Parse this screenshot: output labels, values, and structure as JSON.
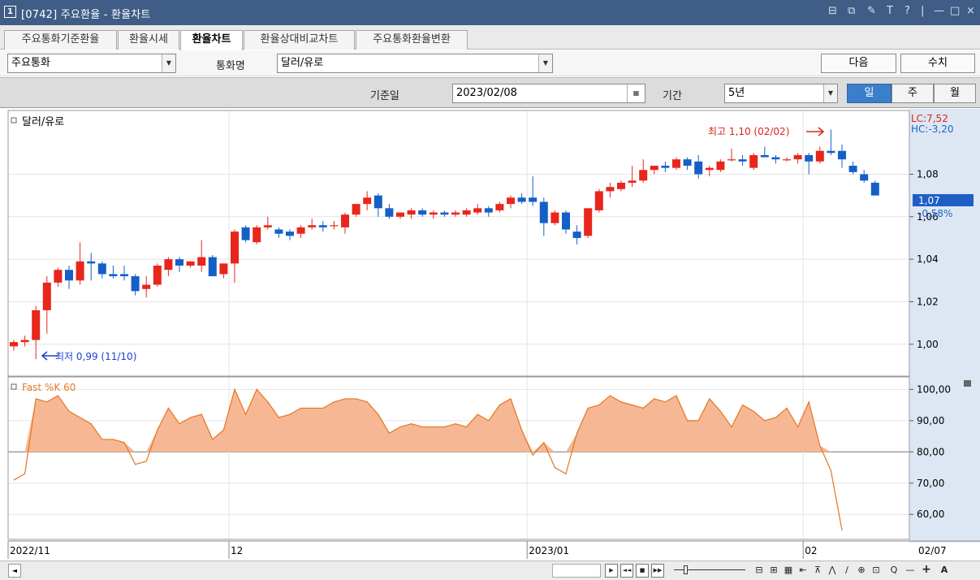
{
  "window": {
    "number": "1",
    "title": "[0742] 주요환율 - 환율차트",
    "controls": [
      "⊟",
      "⧉",
      "✎",
      "T",
      "?",
      "|",
      "—",
      "□",
      "×"
    ]
  },
  "tabs": [
    {
      "label": "주요통화기준환율",
      "active": false
    },
    {
      "label": "환율시세",
      "active": false
    },
    {
      "label": "환율차트",
      "active": true
    },
    {
      "label": "환율상대비교차트",
      "active": false
    },
    {
      "label": "주요통화환율변환",
      "active": false
    }
  ],
  "toolbar": {
    "category_value": "주요통화",
    "currency_label": "통화명",
    "currency_value": "달러/유로",
    "next_label": "다음",
    "value_label": "수치"
  },
  "filters": {
    "base_date_label": "기준일",
    "base_date_value": "2023/02/08",
    "period_label": "기간",
    "period_value": "5년",
    "day_label": "일",
    "week_label": "주",
    "month_label": "월"
  },
  "chart_data": [
    {
      "type": "candlestick",
      "title": "달러/유로",
      "ylim": [
        0.985,
        1.11
      ],
      "yticks": [
        1.0,
        1.02,
        1.04,
        1.06,
        1.08
      ],
      "ytick_labels": [
        "1,00",
        "1,02",
        "1,04",
        "1,06",
        "1,08"
      ],
      "x_labels": [
        "2022/11",
        "12",
        "2023/01",
        "02"
      ],
      "x_label_index": [
        0,
        20,
        47,
        72
      ],
      "last_x_label": "02/07",
      "annotations": {
        "high": "최고 1,10 (02/02)",
        "low": "최저 0,99 (11/10)",
        "lc": "LC:7,52",
        "hc": "HC:-3,20",
        "current": "1,07",
        "change": "-0,58%"
      },
      "candles": [
        {
          "o": 0.999,
          "h": 1.002,
          "l": 0.997,
          "c": 1.001
        },
        {
          "o": 1.001,
          "h": 1.004,
          "l": 0.999,
          "c": 1.002
        },
        {
          "o": 1.002,
          "h": 1.018,
          "l": 0.993,
          "c": 1.016
        },
        {
          "o": 1.016,
          "h": 1.032,
          "l": 1.005,
          "c": 1.029
        },
        {
          "o": 1.029,
          "h": 1.036,
          "l": 1.027,
          "c": 1.035
        },
        {
          "o": 1.035,
          "h": 1.037,
          "l": 1.026,
          "c": 1.03
        },
        {
          "o": 1.03,
          "h": 1.048,
          "l": 1.028,
          "c": 1.039
        },
        {
          "o": 1.039,
          "h": 1.043,
          "l": 1.03,
          "c": 1.038
        },
        {
          "o": 1.038,
          "h": 1.039,
          "l": 1.031,
          "c": 1.033
        },
        {
          "o": 1.033,
          "h": 1.037,
          "l": 1.031,
          "c": 1.032
        },
        {
          "o": 1.033,
          "h": 1.037,
          "l": 1.03,
          "c": 1.032
        },
        {
          "o": 1.032,
          "h": 1.033,
          "l": 1.023,
          "c": 1.025
        },
        {
          "o": 1.026,
          "h": 1.032,
          "l": 1.022,
          "c": 1.028
        },
        {
          "o": 1.028,
          "h": 1.038,
          "l": 1.027,
          "c": 1.037
        },
        {
          "o": 1.035,
          "h": 1.041,
          "l": 1.032,
          "c": 1.04
        },
        {
          "o": 1.04,
          "h": 1.041,
          "l": 1.034,
          "c": 1.037
        },
        {
          "o": 1.037,
          "h": 1.039,
          "l": 1.036,
          "c": 1.039
        },
        {
          "o": 1.037,
          "h": 1.049,
          "l": 1.034,
          "c": 1.041
        },
        {
          "o": 1.041,
          "h": 1.042,
          "l": 1.032,
          "c": 1.032
        },
        {
          "o": 1.033,
          "h": 1.038,
          "l": 1.031,
          "c": 1.038
        },
        {
          "o": 1.038,
          "h": 1.054,
          "l": 1.029,
          "c": 1.053
        },
        {
          "o": 1.055,
          "h": 1.056,
          "l": 1.048,
          "c": 1.049
        },
        {
          "o": 1.048,
          "h": 1.056,
          "l": 1.047,
          "c": 1.055
        },
        {
          "o": 1.055,
          "h": 1.06,
          "l": 1.054,
          "c": 1.056
        },
        {
          "o": 1.054,
          "h": 1.055,
          "l": 1.05,
          "c": 1.052
        },
        {
          "o": 1.053,
          "h": 1.054,
          "l": 1.049,
          "c": 1.051
        },
        {
          "o": 1.052,
          "h": 1.056,
          "l": 1.05,
          "c": 1.055
        },
        {
          "o": 1.055,
          "h": 1.059,
          "l": 1.054,
          "c": 1.056
        },
        {
          "o": 1.056,
          "h": 1.058,
          "l": 1.053,
          "c": 1.055
        },
        {
          "o": 1.056,
          "h": 1.058,
          "l": 1.054,
          "c": 1.056
        },
        {
          "o": 1.055,
          "h": 1.062,
          "l": 1.052,
          "c": 1.061
        },
        {
          "o": 1.061,
          "h": 1.066,
          "l": 1.06,
          "c": 1.066
        },
        {
          "o": 1.066,
          "h": 1.072,
          "l": 1.063,
          "c": 1.069
        },
        {
          "o": 1.07,
          "h": 1.071,
          "l": 1.06,
          "c": 1.064
        },
        {
          "o": 1.064,
          "h": 1.066,
          "l": 1.059,
          "c": 1.06
        },
        {
          "o": 1.06,
          "h": 1.062,
          "l": 1.059,
          "c": 1.062
        },
        {
          "o": 1.061,
          "h": 1.064,
          "l": 1.059,
          "c": 1.063
        },
        {
          "o": 1.063,
          "h": 1.064,
          "l": 1.06,
          "c": 1.061
        },
        {
          "o": 1.061,
          "h": 1.063,
          "l": 1.059,
          "c": 1.062
        },
        {
          "o": 1.062,
          "h": 1.063,
          "l": 1.06,
          "c": 1.061
        },
        {
          "o": 1.061,
          "h": 1.063,
          "l": 1.06,
          "c": 1.062
        },
        {
          "o": 1.061,
          "h": 1.064,
          "l": 1.06,
          "c": 1.063
        },
        {
          "o": 1.062,
          "h": 1.066,
          "l": 1.061,
          "c": 1.064
        },
        {
          "o": 1.064,
          "h": 1.065,
          "l": 1.06,
          "c": 1.062
        },
        {
          "o": 1.063,
          "h": 1.067,
          "l": 1.062,
          "c": 1.066
        },
        {
          "o": 1.066,
          "h": 1.07,
          "l": 1.064,
          "c": 1.069
        },
        {
          "o": 1.069,
          "h": 1.071,
          "l": 1.066,
          "c": 1.067
        },
        {
          "o": 1.069,
          "h": 1.079,
          "l": 1.065,
          "c": 1.067
        },
        {
          "o": 1.067,
          "h": 1.069,
          "l": 1.051,
          "c": 1.057
        },
        {
          "o": 1.057,
          "h": 1.063,
          "l": 1.056,
          "c": 1.062
        },
        {
          "o": 1.062,
          "h": 1.063,
          "l": 1.052,
          "c": 1.054
        },
        {
          "o": 1.053,
          "h": 1.056,
          "l": 1.047,
          "c": 1.05
        },
        {
          "o": 1.051,
          "h": 1.064,
          "l": 1.05,
          "c": 1.064
        },
        {
          "o": 1.063,
          "h": 1.073,
          "l": 1.062,
          "c": 1.072
        },
        {
          "o": 1.072,
          "h": 1.076,
          "l": 1.069,
          "c": 1.074
        },
        {
          "o": 1.073,
          "h": 1.077,
          "l": 1.072,
          "c": 1.076
        },
        {
          "o": 1.076,
          "h": 1.084,
          "l": 1.074,
          "c": 1.077
        },
        {
          "o": 1.077,
          "h": 1.087,
          "l": 1.076,
          "c": 1.082
        },
        {
          "o": 1.082,
          "h": 1.084,
          "l": 1.08,
          "c": 1.084
        },
        {
          "o": 1.084,
          "h": 1.086,
          "l": 1.081,
          "c": 1.083
        },
        {
          "o": 1.083,
          "h": 1.088,
          "l": 1.082,
          "c": 1.087
        },
        {
          "o": 1.087,
          "h": 1.088,
          "l": 1.082,
          "c": 1.084
        },
        {
          "o": 1.086,
          "h": 1.089,
          "l": 1.078,
          "c": 1.08
        },
        {
          "o": 1.082,
          "h": 1.084,
          "l": 1.079,
          "c": 1.083
        },
        {
          "o": 1.082,
          "h": 1.087,
          "l": 1.081,
          "c": 1.086
        },
        {
          "o": 1.087,
          "h": 1.092,
          "l": 1.086,
          "c": 1.087
        },
        {
          "o": 1.087,
          "h": 1.089,
          "l": 1.084,
          "c": 1.086
        },
        {
          "o": 1.083,
          "h": 1.09,
          "l": 1.082,
          "c": 1.089
        },
        {
          "o": 1.089,
          "h": 1.093,
          "l": 1.088,
          "c": 1.088
        },
        {
          "o": 1.088,
          "h": 1.089,
          "l": 1.085,
          "c": 1.087
        },
        {
          "o": 1.087,
          "h": 1.088,
          "l": 1.086,
          "c": 1.087
        },
        {
          "o": 1.087,
          "h": 1.09,
          "l": 1.085,
          "c": 1.089
        },
        {
          "o": 1.089,
          "h": 1.09,
          "l": 1.08,
          "c": 1.086
        },
        {
          "o": 1.086,
          "h": 1.093,
          "l": 1.085,
          "c": 1.091
        },
        {
          "o": 1.091,
          "h": 1.101,
          "l": 1.089,
          "c": 1.09
        },
        {
          "o": 1.091,
          "h": 1.094,
          "l": 1.083,
          "c": 1.087
        },
        {
          "o": 1.084,
          "h": 1.086,
          "l": 1.08,
          "c": 1.081
        },
        {
          "o": 1.08,
          "h": 1.082,
          "l": 1.076,
          "c": 1.077
        },
        {
          "o": 1.076,
          "h": 1.077,
          "l": 1.07,
          "c": 1.07
        }
      ]
    },
    {
      "type": "area",
      "title": "Fast %K 60",
      "ylim": [
        52,
        104
      ],
      "yticks": [
        60,
        70,
        80,
        90,
        100
      ],
      "ytick_labels": [
        "60,00",
        "70,00",
        "80,00",
        "90,00",
        "100,00"
      ],
      "baseline": 80,
      "values": [
        71,
        73,
        97,
        96,
        98,
        93,
        91,
        89,
        84,
        84,
        83,
        76,
        77,
        87,
        94,
        89,
        91,
        92,
        84,
        87,
        100,
        92,
        100,
        96,
        91,
        92,
        94,
        94,
        94,
        96,
        97,
        97,
        96,
        92,
        86,
        88,
        89,
        88,
        88,
        88,
        89,
        88,
        92,
        90,
        95,
        97,
        87,
        79,
        83,
        75,
        73,
        86,
        94,
        95,
        98,
        96,
        95,
        94,
        97,
        96,
        98,
        90,
        90,
        97,
        93,
        88,
        95,
        93,
        90,
        91,
        94,
        88,
        96,
        82,
        74,
        55
      ]
    }
  ],
  "scrollbar": {
    "left_arrow": "◄",
    "transport": [
      "▶",
      "◄◄",
      "■",
      "▶▶"
    ],
    "tools": [
      "⊟",
      "⊞",
      "▦",
      "⇤",
      "⊼",
      "⋀",
      "∕",
      "⊕",
      "⊡",
      "Q",
      "—",
      "+",
      "A"
    ]
  }
}
